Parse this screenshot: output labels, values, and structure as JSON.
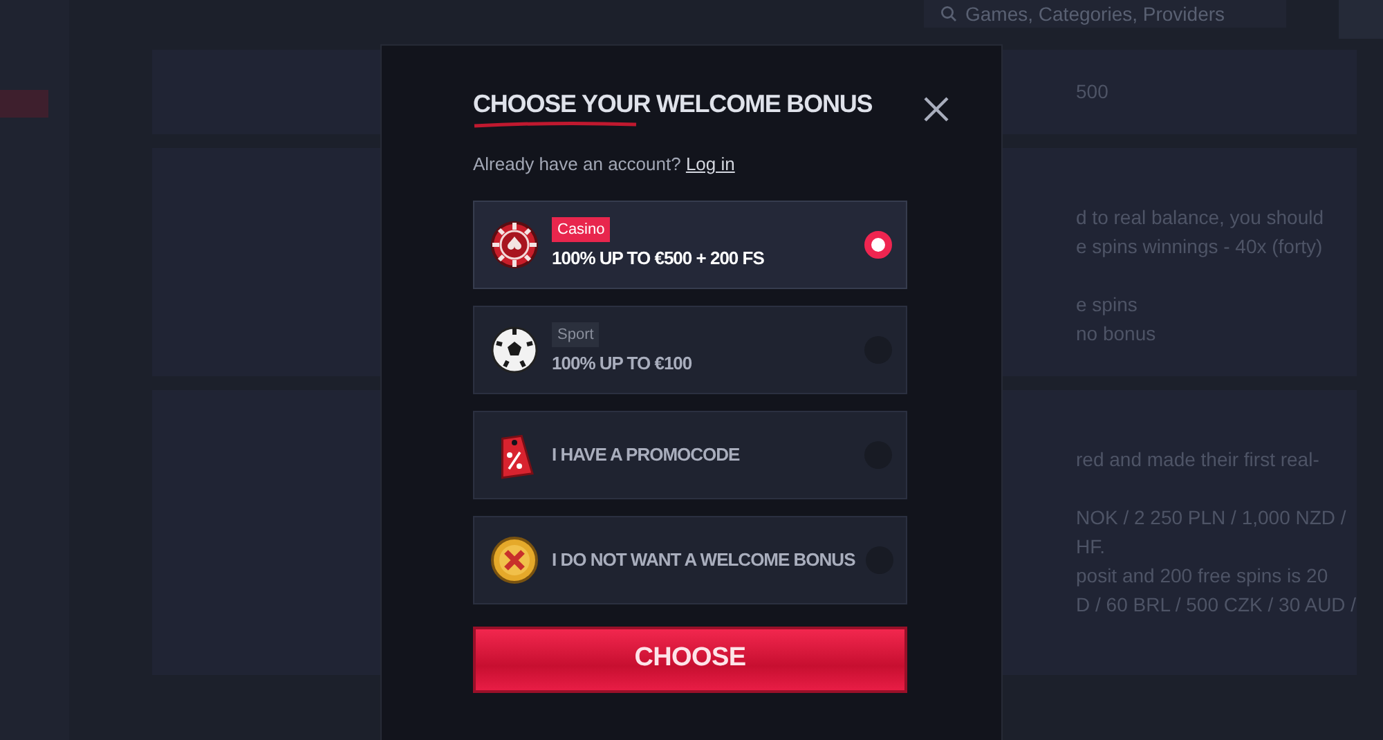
{
  "header": {
    "search": {
      "placeholder": "Games, Categories, Providers"
    }
  },
  "background_panels": [
    {
      "paragraphs": [
        [
          "500"
        ]
      ]
    },
    {
      "paragraphs": [
        [
          "d to real balance, you should",
          "e spins winnings - 40x (forty)"
        ],
        [
          "e spins",
          "no bonus"
        ]
      ]
    },
    {
      "paragraphs": [
        [
          "red and made their first real-"
        ],
        [
          "NOK / 2 250 PLN / 1,000 NZD /",
          "HF.",
          "posit and 200 free spins is 20",
          "D / 60 BRL / 500 CZK / 30 AUD /"
        ]
      ]
    }
  ],
  "modal": {
    "title": "CHOOSE YOUR WELCOME BONUS",
    "login_prompt": "Already have an account?",
    "login_link": "Log in",
    "options": [
      {
        "kind": "casino",
        "tag": "Casino",
        "color": "#e8264d",
        "label": "100% UP TO €500 + 200 FS",
        "selected": true
      },
      {
        "kind": "sport",
        "tag": "Sport",
        "color": "#2b303d",
        "label": "100% UP TO €100",
        "selected": false
      },
      {
        "kind": "promo",
        "label": "I HAVE A PROMOCODE",
        "selected": false
      },
      {
        "kind": "none",
        "label": "I DO NOT WANT A WELCOME BONUS",
        "selected": false
      }
    ],
    "button": "CHOOSE"
  }
}
